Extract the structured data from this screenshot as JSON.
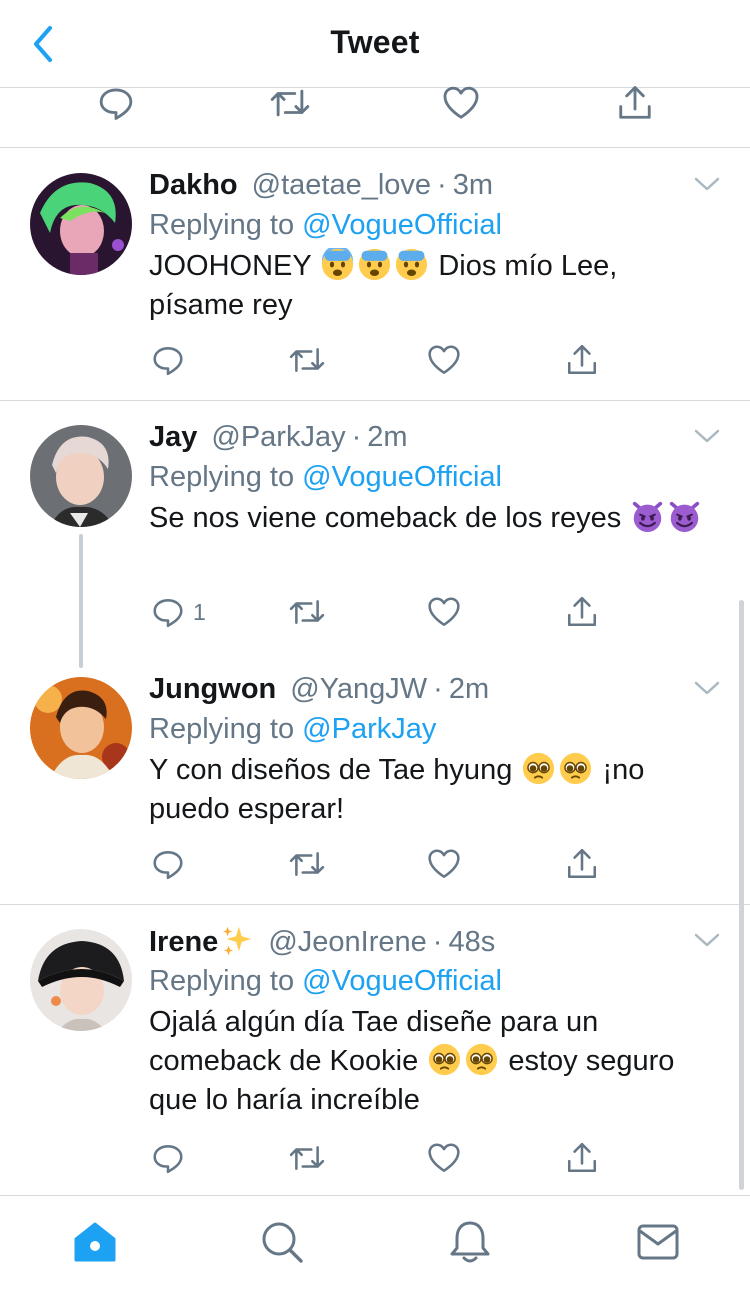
{
  "header": {
    "title": "Tweet"
  },
  "colors": {
    "accent": "#1da1f2",
    "secondary_text": "#657786",
    "text": "#14171a",
    "divider": "#d6dbdf"
  },
  "tweets": [
    {
      "name": "Dakho",
      "handle": "@taetae_love",
      "time": "3m",
      "replying_prefix": "Replying to",
      "replying_to": "@VogueOfficial",
      "text_before": "JOOHONEY",
      "text_after": "Dios mío Lee, písame rey",
      "emojis": [
        "fearful-face-emoji",
        "fearful-face-emoji",
        "fearful-face-emoji"
      ]
    },
    {
      "name": "Jay",
      "handle": "@ParkJay",
      "time": "2m",
      "replying_prefix": "Replying to",
      "replying_to": "@VogueOfficial",
      "text_before": "Se nos viene comeback de los reyes",
      "text_after": "",
      "reply_count": "1",
      "emojis": [
        "smiling-imp-emoji",
        "smiling-imp-emoji"
      ]
    },
    {
      "name": "Jungwon",
      "handle": "@YangJW",
      "time": "2m",
      "replying_prefix": "Replying to",
      "replying_to": "@ParkJay",
      "text_before": "Y con diseños de Tae hyung",
      "text_after": "¡no puedo esperar!",
      "emojis": [
        "pleading-face-emoji",
        "pleading-face-emoji"
      ]
    },
    {
      "name": "Irene",
      "handle": "@JeonIrene",
      "time": "48s",
      "replying_prefix": "Replying to",
      "replying_to": "@VogueOfficial",
      "text_before": "Ojalá algún día Tae diseñe para un comeback de Kookie",
      "text_after": "estoy seguro que lo haría increíble",
      "emojis": [
        "sparkles-emoji",
        "pleading-face-emoji",
        "pleading-face-emoji"
      ]
    }
  ],
  "separator": "·",
  "tabbar": {
    "icons": [
      "home-icon",
      "search-icon",
      "notifications-icon",
      "messages-icon"
    ],
    "active": "home-icon"
  }
}
